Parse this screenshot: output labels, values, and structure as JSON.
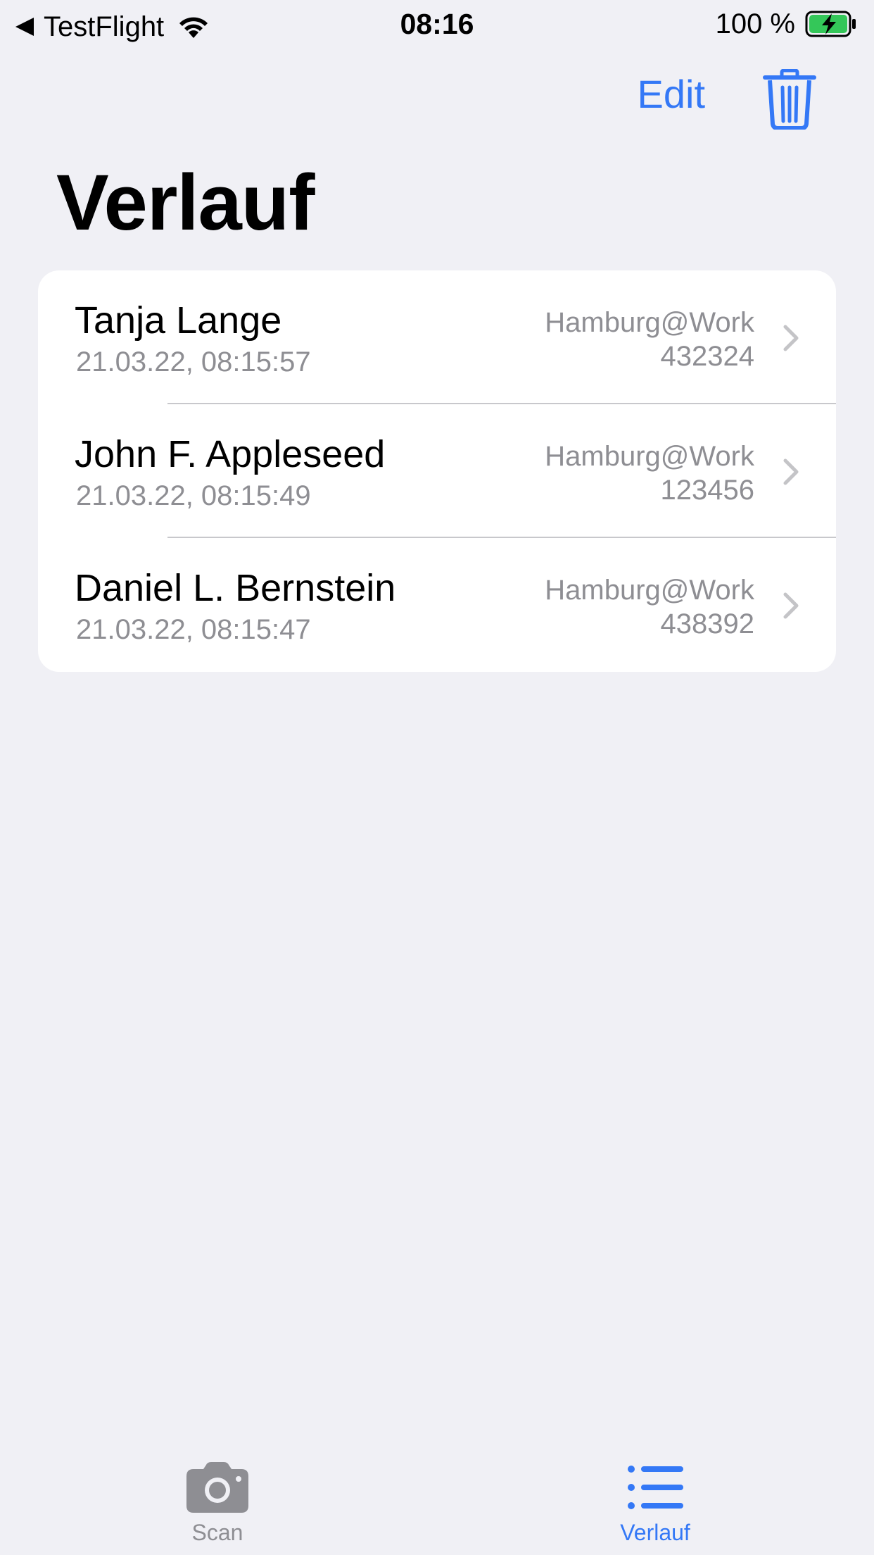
{
  "status_bar": {
    "back_app": "TestFlight",
    "time": "08:16",
    "battery_text": "100 %"
  },
  "nav": {
    "edit_label": "Edit",
    "title": "Verlauf"
  },
  "history": [
    {
      "name": "Tanja Lange",
      "date": "21.03.22, 08:15:57",
      "place": "Hamburg@Work",
      "code": "432324"
    },
    {
      "name": "John F. Appleseed",
      "date": "21.03.22, 08:15:49",
      "place": "Hamburg@Work",
      "code": "123456"
    },
    {
      "name": "Daniel L. Bernstein",
      "date": "21.03.22, 08:15:47",
      "place": "Hamburg@Work",
      "code": "438392"
    }
  ],
  "tabs": [
    {
      "label": "Scan",
      "icon": "camera-icon",
      "selected": false
    },
    {
      "label": "Verlauf",
      "icon": "list-icon",
      "selected": true
    }
  ],
  "colors": {
    "accent": "#3478f6",
    "background": "#f0f0f5",
    "secondary_text": "#8e8e93",
    "battery_charging": "#34c759"
  }
}
